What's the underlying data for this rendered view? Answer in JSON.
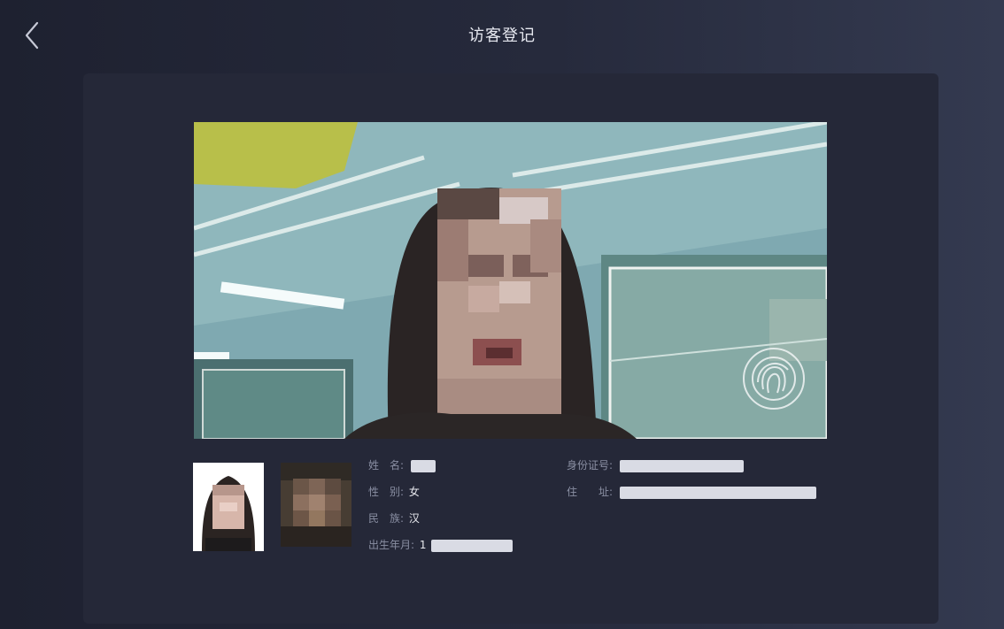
{
  "header": {
    "title": "访客登记",
    "back_icon": "chevron-left-icon"
  },
  "camera": {
    "overlay_icon": "fingerprint-icon"
  },
  "visitor": {
    "name": {
      "label": "姓　名:",
      "value": ""
    },
    "gender": {
      "label": "性　别:",
      "value": "女"
    },
    "ethnicity": {
      "label": "民　族:",
      "value": "汉"
    },
    "birth_date": {
      "label": "出生年月:",
      "value": "1"
    },
    "id_number": {
      "label": "身份证号:",
      "value": ""
    },
    "address": {
      "label": "住　　址:",
      "value": ""
    }
  },
  "colors": {
    "background": "#1e2130",
    "panel": "#252838",
    "label": "#8a8fa3",
    "value": "#e8e9ee"
  }
}
